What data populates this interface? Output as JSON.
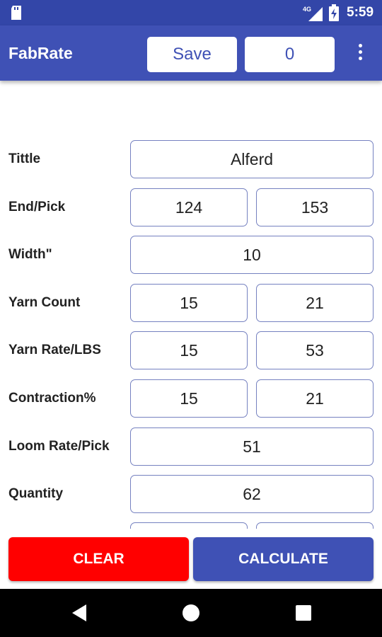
{
  "status_bar": {
    "network_label": "4G",
    "time": "5:59"
  },
  "app_bar": {
    "title": "FabRate",
    "save_label": "Save",
    "count_value": "0",
    "menu_icon": "overflow-menu-icon"
  },
  "form": {
    "title": {
      "label": "Tittle",
      "value": "Alferd"
    },
    "end_pick": {
      "label": "End/Pick",
      "value_1": "124",
      "value_2": "153"
    },
    "width": {
      "label": "Width\"",
      "value": "10"
    },
    "yarn_count": {
      "label": "Yarn Count",
      "value_1": "15",
      "value_2": "21"
    },
    "yarn_rate": {
      "label": "Yarn Rate/LBS",
      "value_1": "15",
      "value_2": "53"
    },
    "contraction": {
      "label": "Contraction%",
      "value_1": "15",
      "value_2": "21"
    },
    "loom_rate": {
      "label": "Loom Rate/Pick",
      "value": "51"
    },
    "quantity": {
      "label": "Quantity",
      "value": "62"
    }
  },
  "actions": {
    "clear_label": "CLEAR",
    "calculate_label": "CALCULATE"
  },
  "colors": {
    "primary": "#3f51b5",
    "status_bar": "#3346a8",
    "clear": "#ff0000",
    "field_border": "#7581c0"
  },
  "nav_bar": {
    "icons": [
      "back-icon",
      "home-icon",
      "recents-icon"
    ]
  }
}
